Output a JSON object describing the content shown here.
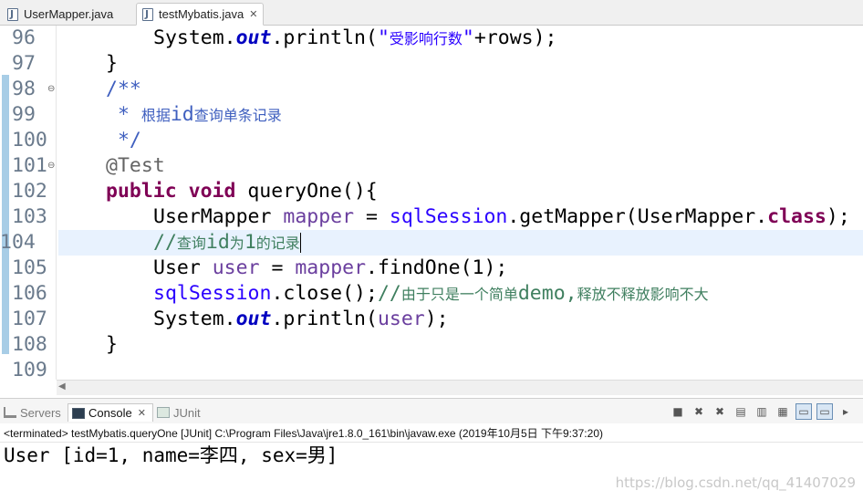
{
  "editor_tabs": [
    {
      "label": "UserMapper.java",
      "active": false
    },
    {
      "label": "testMybatis.java",
      "active": true
    }
  ],
  "code_lines": [
    {
      "num": "96",
      "tokens": [
        {
          "t": "System.",
          "c": ""
        },
        {
          "t": "out",
          "c": "fld"
        },
        {
          "t": ".println(",
          "c": ""
        },
        {
          "t": "\"受影响行数\"",
          "c": "str"
        },
        {
          "t": "+rows);",
          "c": ""
        }
      ]
    },
    {
      "num": "97",
      "tokens": [
        {
          "t": "}",
          "c": ""
        }
      ]
    },
    {
      "num": "98",
      "fold": true,
      "tokens": [
        {
          "t": "/**",
          "c": "doc"
        }
      ]
    },
    {
      "num": "99",
      "tokens": [
        {
          "t": " * 根据id查询单条记录",
          "c": "doc"
        }
      ]
    },
    {
      "num": "100",
      "tokens": [
        {
          "t": " */",
          "c": "doc"
        }
      ]
    },
    {
      "num": "101",
      "fold": true,
      "tokens": [
        {
          "t": "@Test",
          "c": "ann"
        }
      ]
    },
    {
      "num": "102",
      "tokens": [
        {
          "t": "public",
          "c": "kw"
        },
        {
          "t": " ",
          "c": ""
        },
        {
          "t": "void",
          "c": "kw"
        },
        {
          "t": " queryOne(){",
          "c": ""
        }
      ]
    },
    {
      "num": "103",
      "tokens": [
        {
          "t": "UserMapper ",
          "c": ""
        },
        {
          "t": "mapper",
          "c": "var"
        },
        {
          "t": " = ",
          "c": ""
        },
        {
          "t": "sqlSession",
          "c": "str"
        },
        {
          "t": ".getMapper(UserMapper.",
          "c": ""
        },
        {
          "t": "class",
          "c": "kw"
        },
        {
          "t": ");",
          "c": ""
        }
      ]
    },
    {
      "num": "104",
      "current": true,
      "tokens": [
        {
          "t": "//查询id为1的记录",
          "c": "cmt"
        }
      ]
    },
    {
      "num": "105",
      "tokens": [
        {
          "t": "User ",
          "c": ""
        },
        {
          "t": "user",
          "c": "var"
        },
        {
          "t": " = ",
          "c": ""
        },
        {
          "t": "mapper",
          "c": "var"
        },
        {
          "t": ".findOne(1);",
          "c": ""
        }
      ]
    },
    {
      "num": "106",
      "tokens": [
        {
          "t": "sqlSession",
          "c": "str"
        },
        {
          "t": ".close();",
          "c": ""
        },
        {
          "t": "//由于只是一个简单demo,释放不释放影响不大",
          "c": "cmt"
        }
      ]
    },
    {
      "num": "107",
      "tokens": [
        {
          "t": "System.",
          "c": ""
        },
        {
          "t": "out",
          "c": "fld"
        },
        {
          "t": ".println(",
          "c": ""
        },
        {
          "t": "user",
          "c": "var"
        },
        {
          "t": ");",
          "c": ""
        }
      ]
    },
    {
      "num": "108",
      "tokens": [
        {
          "t": "}",
          "c": ""
        }
      ]
    },
    {
      "num": "109",
      "tokens": []
    }
  ],
  "view_tabs": {
    "servers": "Servers",
    "console": "Console",
    "junit": "JUnit"
  },
  "console": {
    "status": "<terminated> testMybatis.queryOne [JUnit] C:\\Program Files\\Java\\jre1.8.0_161\\bin\\javaw.exe (2019年10月5日 下午9:37:20)",
    "output": "User [id=1, name=李四, sex=男]"
  },
  "watermark": "https://blog.csdn.net/qq_41407029",
  "icons": {
    "tab_close": "close-icon",
    "console_close": "close-icon"
  }
}
